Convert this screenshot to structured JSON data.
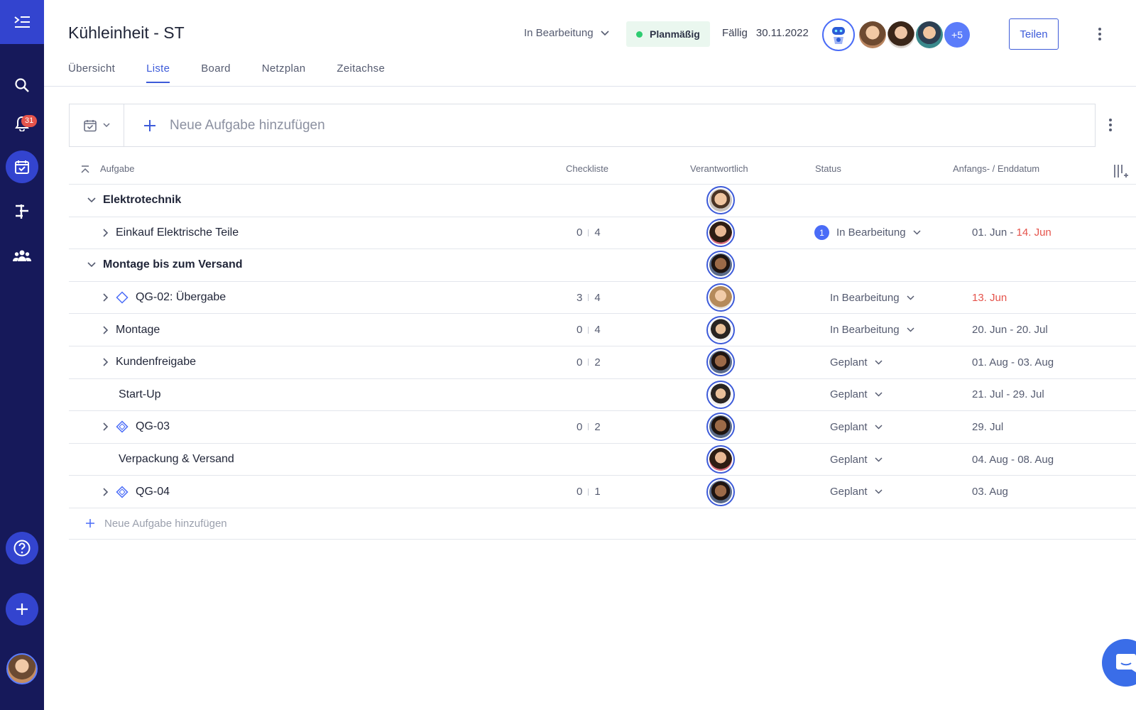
{
  "sidebar": {
    "notification_count": "31"
  },
  "header": {
    "title": "Kühleinheit - ST",
    "status": "In Bearbeitung",
    "pill": "Planmäßig",
    "due_label": "Fällig",
    "due_date": "30.11.2022",
    "more_members": "+5",
    "share": "Teilen"
  },
  "tabs": [
    "Übersicht",
    "Liste",
    "Board",
    "Netzplan",
    "Zeitachse"
  ],
  "addbar": {
    "placeholder": "Neue Aufgabe hinzufügen"
  },
  "columns": {
    "task": "Aufgabe",
    "checklist": "Checkliste",
    "responsible": "Verantwortlich",
    "status": "Status",
    "dates": "Anfangs- / Enddatum"
  },
  "rows": [
    {
      "name": "Elektrotechnik"
    },
    {
      "name": "Einkauf Elektrische Teile",
      "done": "0",
      "total": "4",
      "badge": "1",
      "status": "In Bearbeitung",
      "date_a": "01. Jun - ",
      "date_b": "14. Jun"
    },
    {
      "name": "Montage bis zum Versand"
    },
    {
      "name": "QG-02: Übergabe",
      "done": "3",
      "total": "4",
      "status": "In Bearbeitung",
      "date_b": "13. Jun"
    },
    {
      "name": "Montage",
      "done": "0",
      "total": "4",
      "status": "In Bearbeitung",
      "date_a": "20. Jun - 20. Jul"
    },
    {
      "name": "Kundenfreigabe",
      "done": "0",
      "total": "2",
      "status": "Geplant",
      "date_a": "01. Aug - 03. Aug"
    },
    {
      "name": "Start-Up",
      "status": "Geplant",
      "date_a": "21. Jul - 29. Jul"
    },
    {
      "name": "QG-03",
      "done": "0",
      "total": "2",
      "status": "Geplant",
      "date_a": "29. Jul"
    },
    {
      "name": "Verpackung & Versand",
      "status": "Geplant",
      "date_a": "04. Aug - 08. Aug"
    },
    {
      "name": "QG-04",
      "done": "0",
      "total": "1",
      "status": "Geplant",
      "date_a": "03. Aug"
    }
  ],
  "add_row": "Neue Aufgabe hinzufügen",
  "colors": {
    "accent": "#3d5bd9",
    "sidebar": "#16195a",
    "late": "#e5534b",
    "on_track": "#2ecc71"
  }
}
